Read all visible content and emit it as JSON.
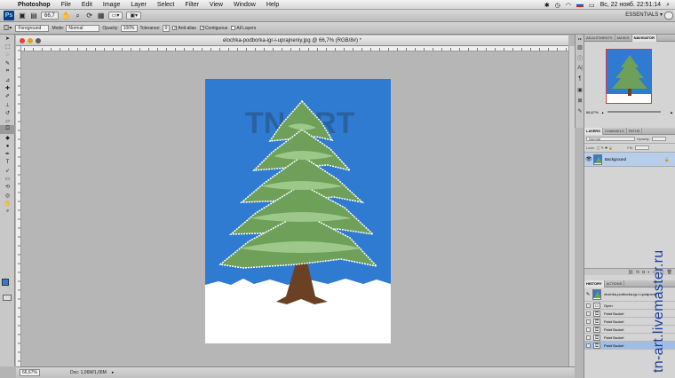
{
  "menubar": {
    "app": "Photoshop",
    "items": [
      "File",
      "Edit",
      "Image",
      "Layer",
      "Select",
      "Filter",
      "View",
      "Window",
      "Help"
    ],
    "clock": "Вс, 22 нояб.  22:51:14"
  },
  "appbar": {
    "zoom": "66,7",
    "workspace": "ESSENTIALS ▾"
  },
  "options": {
    "fill": "Foreground",
    "mode_label": "Mode:",
    "mode": "Normal",
    "opacity_label": "Opacity:",
    "opacity": "100%",
    "tolerance_label": "Tolerance:",
    "tolerance": "0",
    "antialias": "Anti-alias",
    "contiguous": "Contiguous",
    "all_layers": "All Layers"
  },
  "document": {
    "title": "elochka-podborka-igr-i-uprajneniy.jpg @ 66,7% (RGB/8#) *",
    "logo_text": "TN ART"
  },
  "status": {
    "zoom": "66,67%",
    "doc": "Doc: 1,06M/1,06M"
  },
  "navigator": {
    "tabs": [
      "ADJUSTMENTS",
      "MASKS",
      "NAVIGATOR"
    ],
    "zoom": "66,67%"
  },
  "layers": {
    "tabs": [
      "LAYERS",
      "CHANNELS",
      "PATHS"
    ],
    "blend": "Normal",
    "opacity_label": "Opacity:",
    "lock_label": "Lock:",
    "fill_label": "Fill:",
    "layer_name": "Background"
  },
  "history": {
    "tabs": [
      "HISTORY",
      "ACTIONS"
    ],
    "snapshot": "elochka-podborka-igr-i-uprajneniy",
    "steps": [
      "Open",
      "Paint Bucket",
      "Paint Bucket",
      "Paint Bucket",
      "Paint Bucket",
      "Paint Bucket"
    ]
  },
  "watermark": "tn-art.livemaster.ru",
  "colors": {
    "sky": "#2f7bd1",
    "tree": "#6ea05a",
    "trunk": "#6b4126",
    "snow": "#ffffff",
    "accent": "#1a3f9a"
  }
}
